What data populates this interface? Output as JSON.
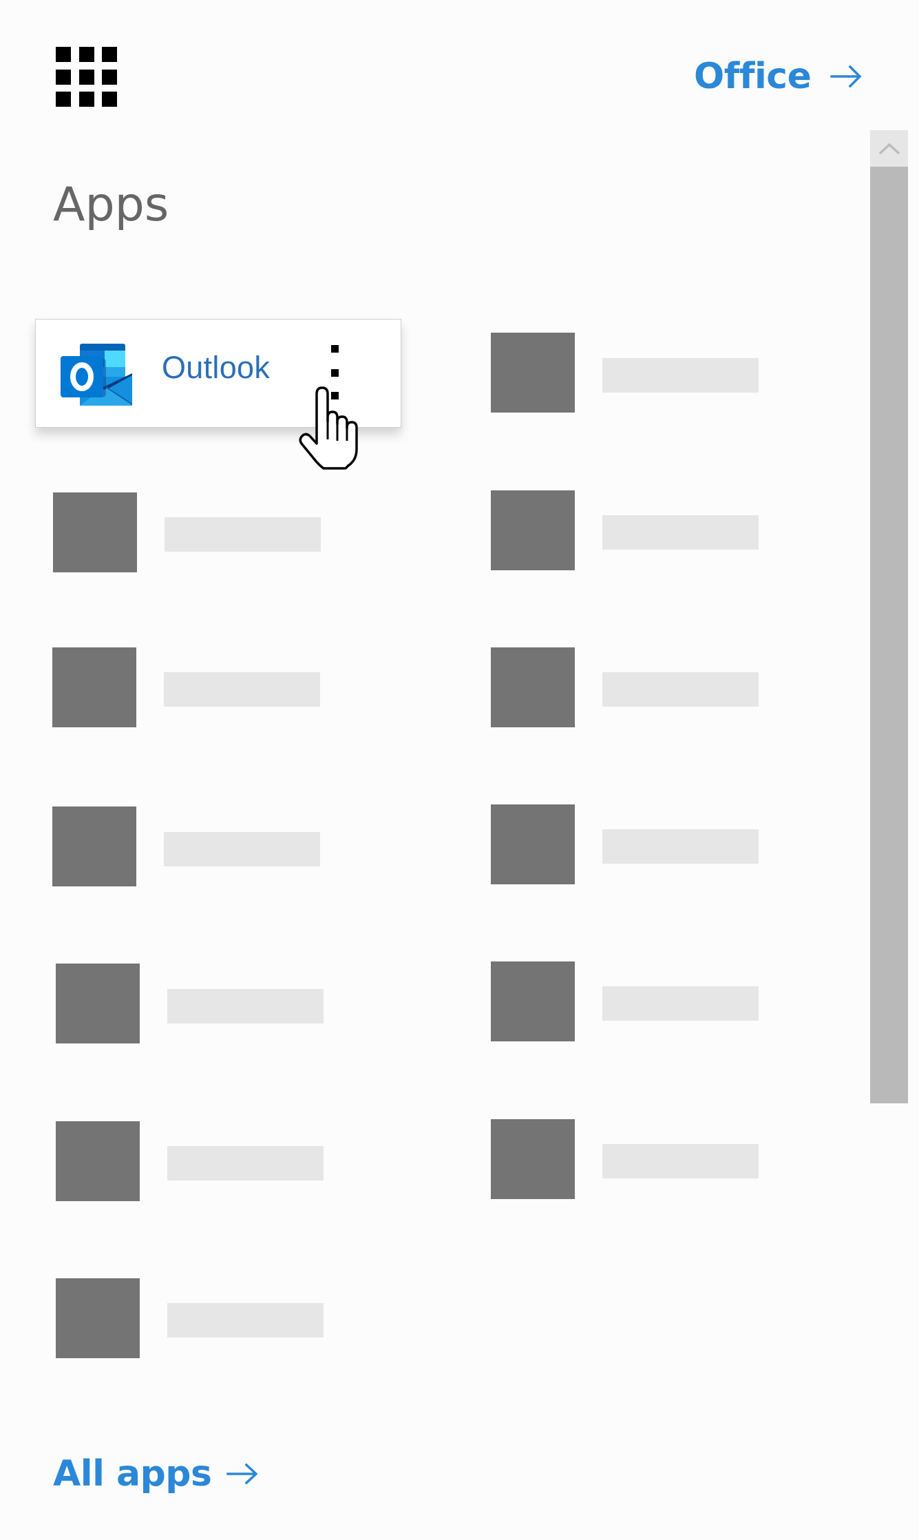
{
  "header": {
    "app_launcher_icon": "waffle-grid-icon",
    "office_link_label": "Office",
    "office_link_icon": "arrow-right-icon"
  },
  "apps_section": {
    "title": "Apps",
    "featured_app": {
      "name": "Outlook",
      "icon": "outlook-icon",
      "more_options_icon": "vertical-ellipsis-icon"
    },
    "placeholder_tiles": {
      "left_column_count": 6,
      "right_column_count": 6
    }
  },
  "footer": {
    "all_apps_label": "All apps",
    "all_apps_icon": "arrow-right-icon"
  },
  "scrollbar": {
    "up_icon": "chevron-up-icon"
  },
  "colors": {
    "link_blue": "#2b88d8",
    "outlook_label": "#2a6fb8",
    "heading_grey": "#666666",
    "tile_grey": "#747474",
    "bar_grey": "#e6e6e6",
    "scroll_thumb": "#b9b9b9"
  }
}
